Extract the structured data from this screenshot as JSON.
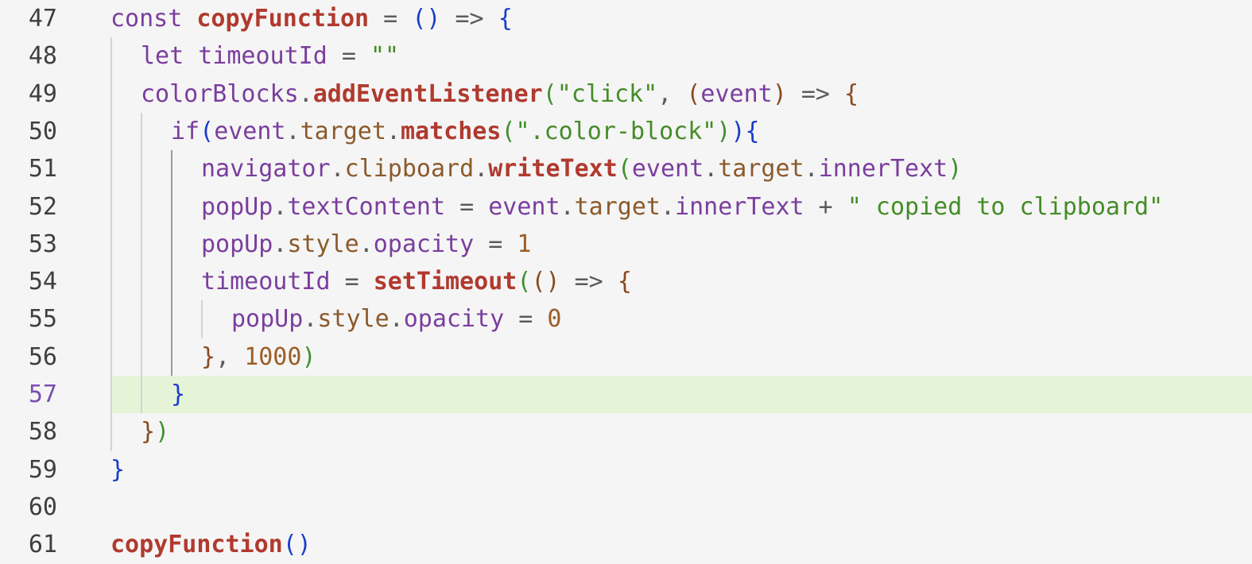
{
  "editor": {
    "active_line": 57,
    "lines": [
      {
        "num": 47,
        "indent": 0,
        "tokens": [
          {
            "t": "const ",
            "c": "kw"
          },
          {
            "t": "copyFunction",
            "c": "fn"
          },
          {
            "t": " = ",
            "c": "op"
          },
          {
            "t": "()",
            "c": "b1"
          },
          {
            "t": " => ",
            "c": "op"
          },
          {
            "t": "{",
            "c": "b1"
          }
        ]
      },
      {
        "num": 48,
        "indent": 1,
        "tokens": [
          {
            "t": "let ",
            "c": "kw"
          },
          {
            "t": "timeoutId",
            "c": "var"
          },
          {
            "t": " = ",
            "c": "op"
          },
          {
            "t": "\"\"",
            "c": "str"
          }
        ]
      },
      {
        "num": 49,
        "indent": 1,
        "tokens": [
          {
            "t": "colorBlocks",
            "c": "var"
          },
          {
            "t": ".",
            "c": "op"
          },
          {
            "t": "addEventListener",
            "c": "fn"
          },
          {
            "t": "(",
            "c": "b3"
          },
          {
            "t": "\"click\"",
            "c": "str"
          },
          {
            "t": ", ",
            "c": "op"
          },
          {
            "t": "(",
            "c": "b2"
          },
          {
            "t": "event",
            "c": "var"
          },
          {
            "t": ")",
            "c": "b2"
          },
          {
            "t": " => ",
            "c": "op"
          },
          {
            "t": "{",
            "c": "b2"
          }
        ]
      },
      {
        "num": 50,
        "indent": 2,
        "tokens": [
          {
            "t": "if",
            "c": "kw"
          },
          {
            "t": "(",
            "c": "b1"
          },
          {
            "t": "event",
            "c": "var"
          },
          {
            "t": ".",
            "c": "op"
          },
          {
            "t": "target",
            "c": "prop"
          },
          {
            "t": ".",
            "c": "op"
          },
          {
            "t": "matches",
            "c": "fn"
          },
          {
            "t": "(",
            "c": "b3"
          },
          {
            "t": "\".color-block\"",
            "c": "str"
          },
          {
            "t": ")",
            "c": "b3"
          },
          {
            "t": ")",
            "c": "b1"
          },
          {
            "t": "{",
            "c": "b1"
          }
        ]
      },
      {
        "num": 51,
        "indent": 3,
        "tokens": [
          {
            "t": "navigator",
            "c": "var"
          },
          {
            "t": ".",
            "c": "op"
          },
          {
            "t": "clipboard",
            "c": "prop"
          },
          {
            "t": ".",
            "c": "op"
          },
          {
            "t": "writeText",
            "c": "fn"
          },
          {
            "t": "(",
            "c": "b3"
          },
          {
            "t": "event",
            "c": "var"
          },
          {
            "t": ".",
            "c": "op"
          },
          {
            "t": "target",
            "c": "prop"
          },
          {
            "t": ".",
            "c": "op"
          },
          {
            "t": "innerText",
            "c": "var"
          },
          {
            "t": ")",
            "c": "b3"
          }
        ]
      },
      {
        "num": 52,
        "indent": 3,
        "tokens": [
          {
            "t": "popUp",
            "c": "var"
          },
          {
            "t": ".",
            "c": "op"
          },
          {
            "t": "textContent",
            "c": "var"
          },
          {
            "t": " = ",
            "c": "op"
          },
          {
            "t": "event",
            "c": "var"
          },
          {
            "t": ".",
            "c": "op"
          },
          {
            "t": "target",
            "c": "prop"
          },
          {
            "t": ".",
            "c": "op"
          },
          {
            "t": "innerText",
            "c": "var"
          },
          {
            "t": " + ",
            "c": "op"
          },
          {
            "t": "\" copied to clipboard\"",
            "c": "str"
          }
        ]
      },
      {
        "num": 53,
        "indent": 3,
        "tokens": [
          {
            "t": "popUp",
            "c": "var"
          },
          {
            "t": ".",
            "c": "op"
          },
          {
            "t": "style",
            "c": "prop"
          },
          {
            "t": ".",
            "c": "op"
          },
          {
            "t": "opacity",
            "c": "var"
          },
          {
            "t": " = ",
            "c": "op"
          },
          {
            "t": "1",
            "c": "num"
          }
        ]
      },
      {
        "num": 54,
        "indent": 3,
        "tokens": [
          {
            "t": "timeoutId",
            "c": "var"
          },
          {
            "t": " = ",
            "c": "op"
          },
          {
            "t": "setTimeout",
            "c": "fn"
          },
          {
            "t": "(",
            "c": "b3"
          },
          {
            "t": "()",
            "c": "b2"
          },
          {
            "t": " => ",
            "c": "op"
          },
          {
            "t": "{",
            "c": "b2"
          }
        ]
      },
      {
        "num": 55,
        "indent": 4,
        "tokens": [
          {
            "t": "popUp",
            "c": "var"
          },
          {
            "t": ".",
            "c": "op"
          },
          {
            "t": "style",
            "c": "prop"
          },
          {
            "t": ".",
            "c": "op"
          },
          {
            "t": "opacity",
            "c": "var"
          },
          {
            "t": " = ",
            "c": "op"
          },
          {
            "t": "0",
            "c": "num"
          }
        ]
      },
      {
        "num": 56,
        "indent": 3,
        "tokens": [
          {
            "t": "}",
            "c": "b2"
          },
          {
            "t": ", ",
            "c": "op"
          },
          {
            "t": "1000",
            "c": "num"
          },
          {
            "t": ")",
            "c": "b3"
          }
        ]
      },
      {
        "num": 57,
        "indent": 2,
        "tokens": [
          {
            "t": "}",
            "c": "b1"
          }
        ]
      },
      {
        "num": 58,
        "indent": 1,
        "tokens": [
          {
            "t": "}",
            "c": "b2"
          },
          {
            "t": ")",
            "c": "b3"
          }
        ]
      },
      {
        "num": 59,
        "indent": 0,
        "tokens": [
          {
            "t": "}",
            "c": "b1"
          }
        ]
      },
      {
        "num": 60,
        "indent": 0,
        "tokens": []
      },
      {
        "num": 61,
        "indent": 0,
        "tokens": [
          {
            "t": "copyFunction",
            "c": "fn"
          },
          {
            "t": "()",
            "c": "b1"
          }
        ]
      }
    ]
  }
}
